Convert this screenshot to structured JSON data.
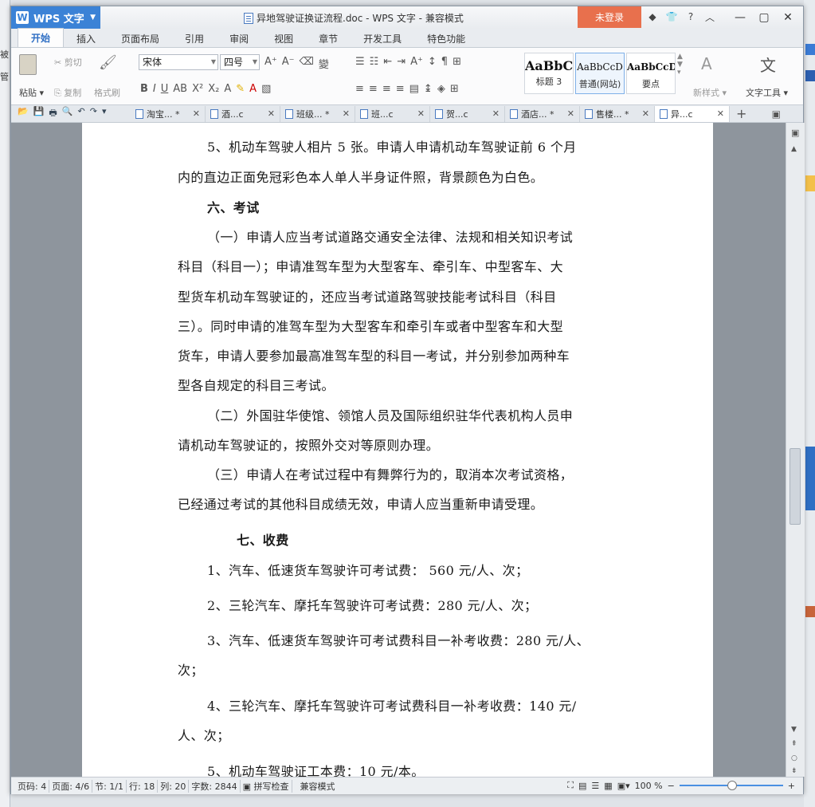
{
  "app": {
    "menu_label": "WPS 文字",
    "window_title": "异地驾驶证换证流程.doc - WPS 文字 - 兼容模式",
    "login_label": "未登录"
  },
  "ribbon_tabs": [
    "开始",
    "插入",
    "页面布局",
    "引用",
    "审阅",
    "视图",
    "章节",
    "开发工具",
    "特色功能"
  ],
  "ribbon": {
    "paste": "粘贴",
    "cut": "剪切",
    "copy": "复制",
    "format_painter": "格式刷",
    "font_name": "宋体",
    "font_size": "四号",
    "styles": [
      {
        "sample": "AaBbC",
        "name": "标题 3"
      },
      {
        "sample": "AaBbCcD",
        "name": "普通(网站)"
      },
      {
        "sample": "AaBbCcD",
        "name": "要点"
      }
    ],
    "new_style": "新样式",
    "text_tools": "文字工具"
  },
  "doc_tabs": [
    {
      "label": "淘宝... *"
    },
    {
      "label": "酒...c"
    },
    {
      "label": "班级... *"
    },
    {
      "label": "班...c"
    },
    {
      "label": "贺...c"
    },
    {
      "label": "酒店... *"
    },
    {
      "label": "售楼... *"
    },
    {
      "label": "异...c",
      "active": true
    }
  ],
  "document": {
    "lines": [
      "5、机动车驾驶人相片 5 张。申请人申请机动车驾驶证前 6 个月",
      "内的直边正面免冠彩色本人单人半身证件照，背景颜色为白色。",
      "六、考试",
      "（一）申请人应当考试道路交通安全法律、法规和相关知识考试",
      "科目（科目一）；申请准驾车型为大型客车、牵引车、中型客车、大",
      "型货车机动车驾驶证的，还应当考试道路驾驶技能考试科目（科目",
      "三）。同时申请的准驾车型为大型客车和牵引车或者中型客车和大型",
      "货车，申请人要参加最高准驾车型的科目一考试，并分别参加两种车",
      "型各自规定的科目三考试。",
      "（二）外国驻华使馆、领馆人员及国际组织驻华代表机构人员申",
      "请机动车驾驶证的，按照外交对等原则办理。",
      "（三）申请人在考试过程中有舞弊行为的，取消本次考试资格，",
      "已经通过考试的其他科目成绩无效，申请人应当重新申请受理。",
      "七、收费",
      "1、汽车、低速货车驾驶许可考试费：  560 元/人、次；",
      "2、三轮汽车、摩托车驾驶许可考试费：280 元/人、次；",
      "3、汽车、低速货车驾驶许可考试费科目一补考收费：280 元/人、",
      "次；",
      "4、三轮汽车、摩托车驾驶许可考试费科目一补考收费：140 元/",
      "人、次；",
      "5、机动车驾驶证工本费：10 元/本。"
    ]
  },
  "status": {
    "page_code": "页码: 4",
    "pages": "页面: 4/6",
    "section": "节: 1/1",
    "row": "行: 18",
    "col": "列: 20",
    "word_count": "字数: 2844",
    "spell_check": "拼写检查",
    "compat": "兼容模式",
    "zoom": "100 %"
  }
}
